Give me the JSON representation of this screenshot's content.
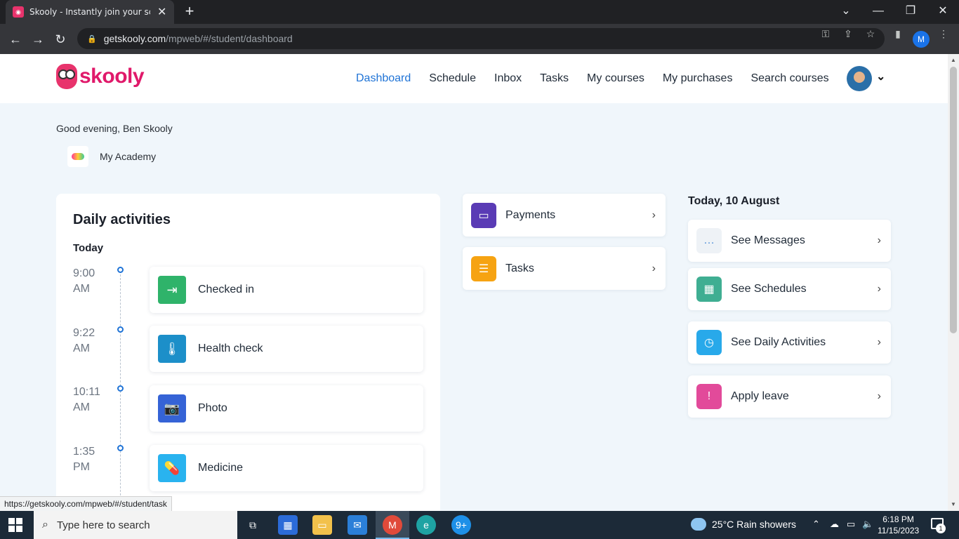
{
  "browser": {
    "tab_title": "Skooly - Instantly join your school",
    "url_host": "getskooly.com",
    "url_path": "/mpweb/#/student/dashboard",
    "profile_initial": "M",
    "status_url": "https://getskooly.com/mpweb/#/student/task"
  },
  "header": {
    "logo_text": "skooly",
    "nav": [
      "Dashboard",
      "Schedule",
      "Inbox",
      "Tasks",
      "My courses",
      "My purchases",
      "Search courses"
    ],
    "active_nav": "Dashboard"
  },
  "greeting": "Good evening, Ben Skooly",
  "academy_name": "My Academy",
  "daily": {
    "title": "Daily activities",
    "day_label": "Today",
    "activities": [
      {
        "time": "9:00",
        "ampm": "AM",
        "label": "Checked in",
        "icon": "check-in-icon",
        "color": "#2fb36a"
      },
      {
        "time": "9:22",
        "ampm": "AM",
        "label": "Health check",
        "icon": "thermometer-icon",
        "color": "#1c8fc9"
      },
      {
        "time": "10:11",
        "ampm": "AM",
        "label": "Photo",
        "icon": "camera-icon",
        "color": "#3563d6"
      },
      {
        "time": "1:35",
        "ampm": "PM",
        "label": "Medicine",
        "icon": "pill-icon",
        "color": "#29b3ef"
      }
    ]
  },
  "middle": [
    {
      "label": "Payments",
      "icon": "payment-card-icon",
      "color": "#5a3bb5"
    },
    {
      "label": "Tasks",
      "icon": "task-list-icon",
      "color": "#f6a312"
    }
  ],
  "right": {
    "date": "Today, 10 August",
    "items": [
      {
        "label": "See Messages",
        "icon": "messages-icon",
        "color": "#eef2f6"
      },
      {
        "label": "See Schedules",
        "icon": "calendar-icon",
        "color": "#3fae92"
      },
      {
        "label": "See Daily Activities",
        "icon": "clock-icon",
        "color": "#28a9ea"
      },
      {
        "label": "Apply leave",
        "icon": "leave-calendar-icon",
        "color": "#e24a9a"
      }
    ]
  },
  "taskbar": {
    "search_placeholder": "Type here to search",
    "weather": "25°C  Rain showers",
    "time": "6:18 PM",
    "date": "11/15/2023",
    "notif_count": "1",
    "chrome_badge": "M",
    "skype_badge": "9+"
  }
}
